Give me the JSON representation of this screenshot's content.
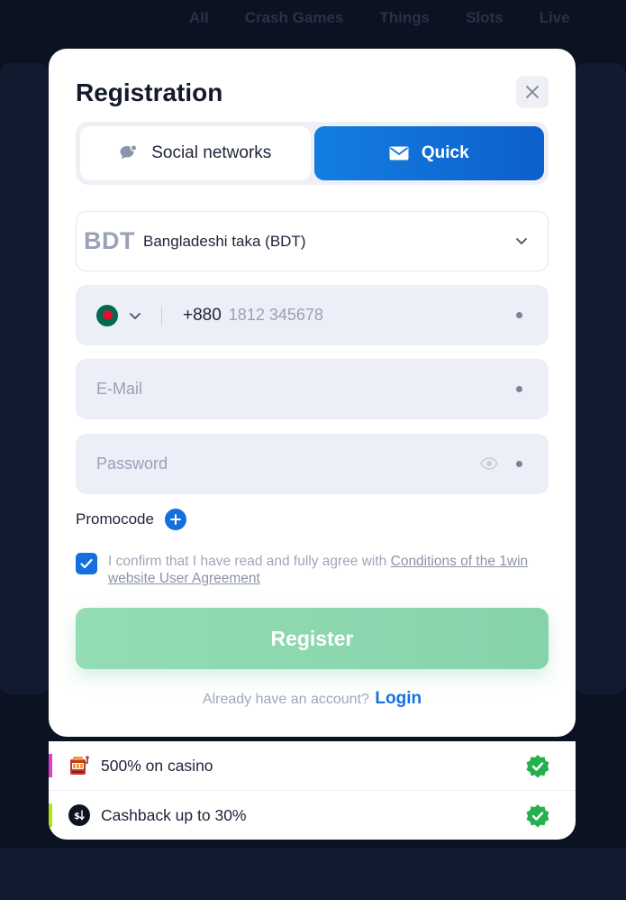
{
  "background_nav": [
    "All",
    "Crash Games",
    "Things",
    "Slots",
    "Live"
  ],
  "modal": {
    "title": "Registration",
    "tabs": [
      {
        "label": "Social networks",
        "active": false,
        "icon": "chat-bubble-icon"
      },
      {
        "label": "Quick",
        "active": true,
        "icon": "envelope-icon"
      }
    ],
    "currency": {
      "code": "BDT",
      "name": "Bangladeshi taka (BDT)"
    },
    "phone": {
      "prefix": "+880",
      "placeholder": "1812 345678",
      "flag": "bangladesh-flag-icon"
    },
    "email": {
      "placeholder": "E-Mail"
    },
    "password": {
      "placeholder": "Password"
    },
    "promocode_label": "Promocode",
    "agreement": {
      "checked": true,
      "text": "I confirm that I have read and fully agree with ",
      "link": "Conditions of the 1win website User Agreement"
    },
    "register_label": "Register",
    "login_prompt": "Already have an account?",
    "login_link": "Login"
  },
  "bonuses": [
    {
      "label": "500% on casino",
      "icon": "slot-machine-icon",
      "stripe_color": "#e040c8"
    },
    {
      "label": "Cashback up to 30%",
      "icon": "cashback-icon",
      "stripe_color": "#b6e21a"
    }
  ],
  "colors": {
    "accent": "#1570de",
    "register": "#8ed8b0",
    "badge": "#23b14d",
    "field_bg": "#eceff7"
  }
}
